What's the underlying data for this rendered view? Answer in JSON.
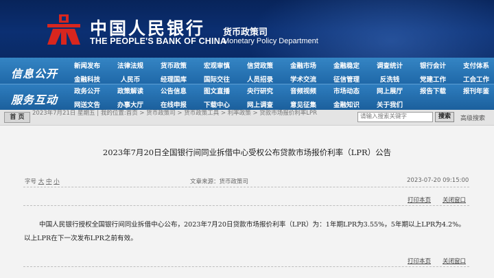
{
  "header": {
    "bank_name_cn": "中国人民银行",
    "bank_name_en": "THE PEOPLE'S BANK OF CHINA",
    "dept_cn": "货币政策司",
    "dept_en": "Monetary Policy Department"
  },
  "nav": {
    "row1_title": "信息公开",
    "row2_title": "服务互动",
    "row1a": [
      "新闻发布",
      "法律法规",
      "货币政策",
      "宏观审慎",
      "信贷政策",
      "金融市场",
      "金融稳定",
      "调查统计",
      "银行会计",
      "支付体系"
    ],
    "row1b": [
      "金融科技",
      "人民币",
      "经理国库",
      "国际交往",
      "人员招录",
      "学术交流",
      "征信管理",
      "反洗钱",
      "党建工作",
      "工会工作"
    ],
    "row2a": [
      "政务公开",
      "政策解读",
      "公告信息",
      "图文直播",
      "央行研究",
      "音频视频",
      "市场动态",
      "网上展厅",
      "报告下载",
      "报刊年鉴"
    ],
    "row2b": [
      "网送文告",
      "办事大厅",
      "在线申报",
      "下载中心",
      "网上调查",
      "意见征集",
      "金融知识",
      "关于我们"
    ]
  },
  "breadcrumb": {
    "home_label": "首 页",
    "text": "2023年7月21日  星期五  |  我的位置:首页    >    货币政策司    >    货币政策工具    >    利率政策    >    贷款市场报价利率LPR",
    "search_placeholder": "请输入搜索关键字",
    "search_button": "搜索",
    "advanced_search": "高级搜索"
  },
  "article": {
    "title": "2023年7月20日全国银行间同业拆借中心受权公布贷款市场报价利率（LPR）公告",
    "font_size_label": "字号",
    "font_large": "大",
    "font_medium": "中",
    "font_small": "小",
    "source": "文章来源：货币政策司",
    "datetime": "2023-07-20  09:15:00",
    "print_label": "打印本页",
    "close_label": "关闭窗口",
    "body": "中国人民银行授权全国银行间同业拆借中心公布，2023年7月20日贷款市场报价利率（LPR）为：1年期LPR为3.55%，5年期以上LPR为4.2%。以上LPR在下一次发布LPR之前有效。"
  },
  "colors": {
    "header_bg": "#0b2f72",
    "nav_bg": "#1f68a8",
    "logo_red": "#d8261e"
  }
}
